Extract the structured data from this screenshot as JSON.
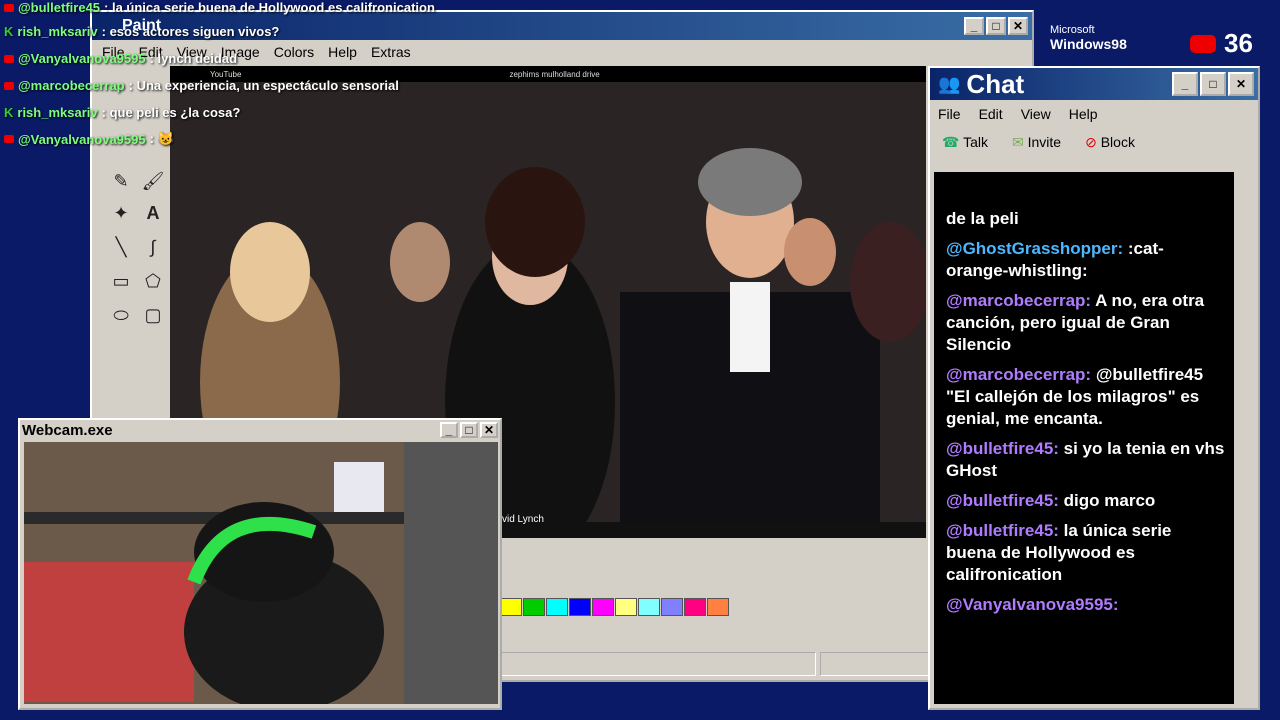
{
  "overlay_chat": [
    {
      "user": "@bulletfire45",
      "text": ": la única serie buena de Hollywood es califronication",
      "platform": "youtube"
    },
    {
      "user": "rish_mksariv",
      "text": ": esos actores siguen vivos?",
      "platform": "kick"
    },
    {
      "user": "@Vanyalvanova9595",
      "text": ": lynch deidad",
      "platform": "youtube"
    },
    {
      "user": "@marcobecerrap",
      "text": ": Una experiencia, un espectáculo sensorial",
      "platform": "youtube"
    },
    {
      "user": "rish_mksariv",
      "text": ": que peli es ¿la cosa?",
      "platform": "kick"
    },
    {
      "user": "@Vanyalvanova9595",
      "text": ": 😺",
      "platform": "youtube"
    }
  ],
  "viewer_count": "36",
  "win98_badge": "Windows98",
  "ms_badge": "Microsoft",
  "paint": {
    "title": "Paint",
    "menu": [
      "File",
      "Edit",
      "View",
      "Image",
      "Colors",
      "Help",
      "Extras"
    ],
    "youtube_label": "YouTube",
    "search_text": "zephims mulholland drive",
    "caption": "vid Lynch",
    "palette": [
      "#ffff00",
      "#00cc00",
      "#00ffff",
      "#0000ff",
      "#ff00ff",
      "#ffff80",
      "#80ffff",
      "#8080ff",
      "#ff0080",
      "#ff8040"
    ]
  },
  "chat": {
    "title": "Chat",
    "menu": [
      "File",
      "Edit",
      "View",
      "Help"
    ],
    "tools": [
      "Talk",
      "Invite",
      "Block"
    ],
    "messages": [
      {
        "user": "",
        "text": "de la peli"
      },
      {
        "user": "@GhostGrasshopper:",
        "text": " :cat-orange-whistling:",
        "color": "blue"
      },
      {
        "user": "@marcobecerrap:",
        "text": " A no, era otra canción, pero igual de Gran Silencio"
      },
      {
        "user": "@marcobecerrap:",
        "text": " @bulletfire45 \"El callejón de los milagros\" es genial, me encanta."
      },
      {
        "user": "@bulletfire45:",
        "text": " si yo la tenia en vhs GHost"
      },
      {
        "user": "@bulletfire45:",
        "text": " digo marco"
      },
      {
        "user": "@bulletfire45:",
        "text": " la única serie buena de Hollywood es califronication"
      },
      {
        "user": "@VanyaIvanova9595:",
        "text": ""
      }
    ]
  },
  "webcam": {
    "title": "Webcam.exe"
  }
}
